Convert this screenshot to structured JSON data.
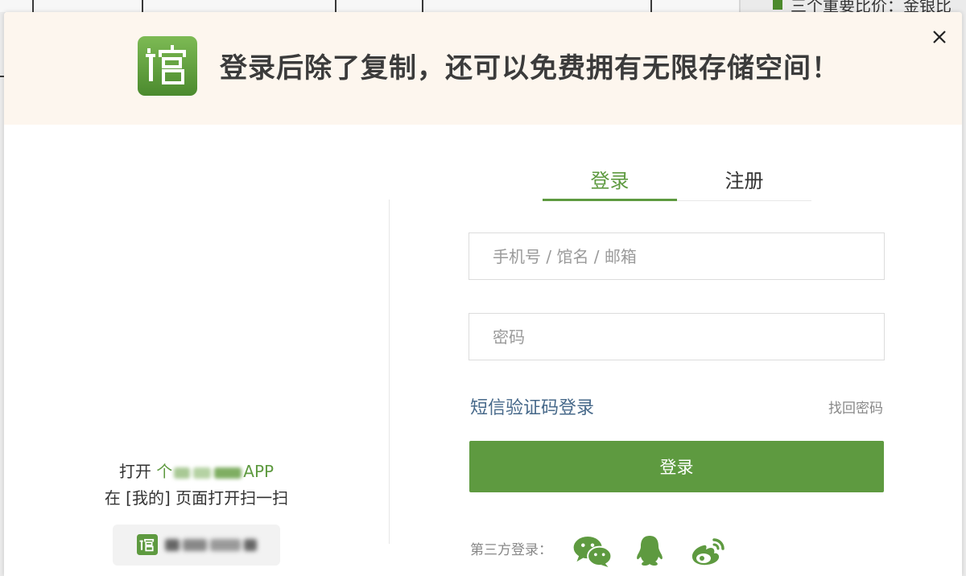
{
  "background_page": {
    "heading": "三个重要比价：金银比"
  },
  "modal": {
    "title": "登录后除了复制，还可以免费拥有无限存储空间！",
    "logo_icon": "library-logo-icon",
    "close_icon": "close-icon",
    "qr_panel": {
      "open_prefix": "打开",
      "app_name_start": "个",
      "app_name_end": "APP",
      "scan_hint": "在 [我的] 页面打开扫一扫",
      "download_icon": "library-logo-icon"
    },
    "tabs": [
      {
        "label": "登录",
        "active": true
      },
      {
        "label": "注册",
        "active": false
      }
    ],
    "form": {
      "account_placeholder": "手机号 / 馆名 / 邮箱",
      "account_value": "",
      "password_placeholder": "密码",
      "password_value": "",
      "sms_login_link": "短信验证码登录",
      "forgot_password_link": "找回密码",
      "submit_label": "登录"
    },
    "third_party": {
      "label": "第三方登录：",
      "providers": [
        "wechat-icon",
        "qq-icon",
        "weibo-icon"
      ]
    }
  },
  "colors": {
    "accent": "#5e9a40",
    "link": "#47698a",
    "header_background": "#fdf6ee"
  }
}
